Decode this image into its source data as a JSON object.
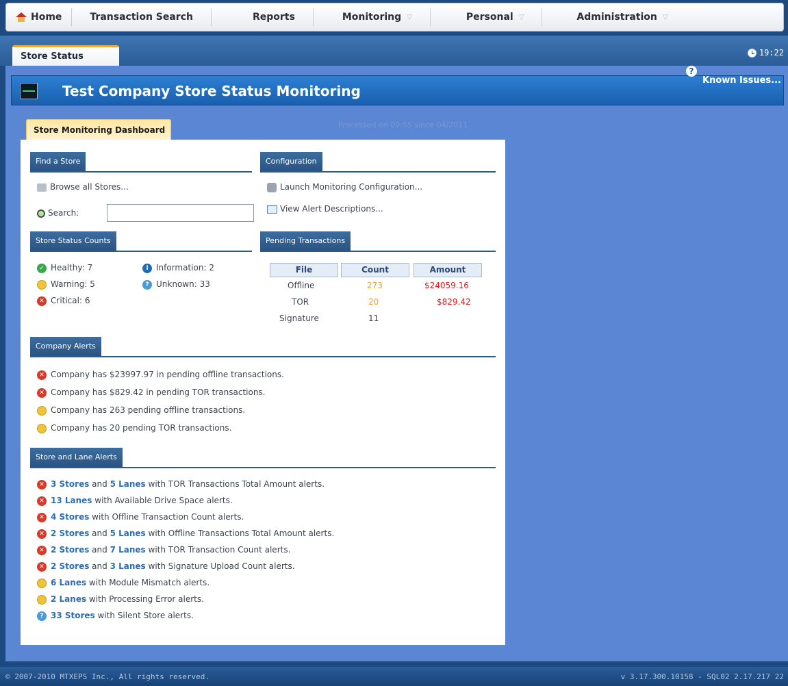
{
  "nav": {
    "home": "Home",
    "transaction_search": "Transaction Search",
    "reports": "Reports",
    "monitoring": "Monitoring",
    "personal": "Personal",
    "administration": "Administration"
  },
  "tab": {
    "label": "Store Status"
  },
  "clock": "19:22",
  "banner": {
    "title": "Test Company Store Status Monitoring",
    "known_issues": "Known Issues..."
  },
  "dashboard": {
    "tab": "Store Monitoring Dashboard",
    "processed": "Processed on 09:55 since 04/2011"
  },
  "find_store": {
    "heading": "Find a Store",
    "browse": "Browse all Stores...",
    "search_label": "Search:",
    "search_value": ""
  },
  "configuration": {
    "heading": "Configuration",
    "launch": "Launch Monitoring Configuration...",
    "view_alerts": "View Alert Descriptions..."
  },
  "status_counts": {
    "heading": "Store Status Counts",
    "healthy": "Healthy: 7",
    "warning": "Warning: 5",
    "critical": "Critical: 6",
    "information": "Information: 2",
    "unknown": "Unknown: 33"
  },
  "pending": {
    "heading": "Pending Transactions",
    "columns": [
      "File",
      "Count",
      "Amount"
    ],
    "rows": [
      {
        "file": "Offline",
        "count": "273",
        "amount": "$24059.16"
      },
      {
        "file": "TOR",
        "count": "20",
        "amount": "$829.42"
      },
      {
        "file": "Signature",
        "count": "11",
        "amount": ""
      }
    ]
  },
  "company_alerts": {
    "heading": "Company Alerts",
    "items": [
      "Company has $23997.97 in pending offline transactions.",
      "Company has $829.42 in pending TOR transactions.",
      "Company has 263 pending offline transactions.",
      "Company has 20 pending TOR transactions."
    ]
  },
  "lane_alerts": {
    "heading": "Store and Lane Alerts",
    "items": [
      {
        "a": "3 Stores",
        "mid": " and ",
        "b": "5 Lanes",
        "rest": " with TOR Transactions Total Amount alerts."
      },
      {
        "a": "13 Lanes",
        "mid": "",
        "b": "",
        "rest": " with Available Drive Space alerts."
      },
      {
        "a": "4 Stores",
        "mid": "",
        "b": "",
        "rest": " with Offline Transaction Count alerts."
      },
      {
        "a": "2 Stores",
        "mid": " and ",
        "b": "5 Lanes",
        "rest": " with Offline Transactions Total Amount alerts."
      },
      {
        "a": "2 Stores",
        "mid": " and ",
        "b": "7 Lanes",
        "rest": " with TOR Transaction Count alerts."
      },
      {
        "a": "2 Stores",
        "mid": " and ",
        "b": "3 Lanes",
        "rest": " with Signature Upload Count alerts."
      },
      {
        "a": "6 Lanes",
        "mid": "",
        "b": "",
        "rest": " with Module Mismatch alerts."
      },
      {
        "a": "2 Lanes",
        "mid": "",
        "b": "",
        "rest": " with Processing Error alerts."
      },
      {
        "a": "33 Stores",
        "mid": "",
        "b": "",
        "rest": " with Silent Store alerts."
      }
    ]
  },
  "footer": {
    "copyright": "© 2007-2010 MTXEPS Inc., All rights reserved.",
    "version": "v 3.17.300.10158 - SQL02 2.17.217 22"
  },
  "colors": {
    "healthy": "#39a848",
    "warning": "#f0c43a",
    "critical": "#d63a2b",
    "information": "#1f6bb8",
    "unknown": "#4a9ad8"
  }
}
